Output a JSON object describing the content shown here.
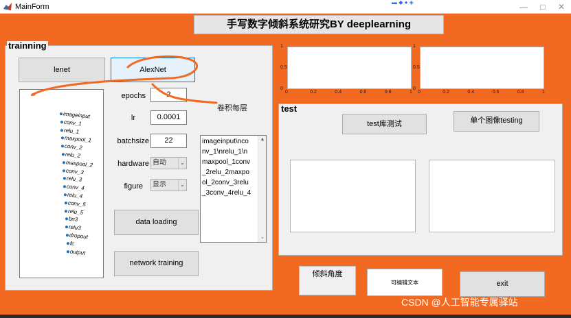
{
  "window": {
    "title": "MainForm",
    "controls": [
      "—",
      "□",
      "✕"
    ]
  },
  "header": {
    "title": "手写数字倾斜系统研究BY deeplearning"
  },
  "training": {
    "label": "trainning",
    "lenet_label": "lenet",
    "alexnet_label": "AlexNet",
    "epochs_label": "epochs",
    "epochs_value": "2",
    "lr_label": "lr",
    "lr_value": "0.0001",
    "batchsize_label": "batchsize",
    "batchsize_value": "22",
    "hardware_label": "hardware",
    "hardware_value": "自动",
    "figure_label": "figure",
    "figure_value": "显示",
    "data_loading_label": "data loading",
    "network_training_label": "network training",
    "layers": [
      "imageinput",
      "conv_1",
      "relu_1",
      "maxpool_1",
      "conv_2",
      "relu_2",
      "maxpool_2",
      "conv_3",
      "relu_3",
      "conv_4",
      "relu_4",
      "conv_5",
      "relu_5",
      "bn3",
      "relu3",
      "dropout",
      "fc",
      "output"
    ],
    "layer_text_lines": [
      "imageinput\\nco",
      "nv_1\\nrelu_1\\n",
      "maxpool_1conv",
      "_2relu_2maxpo",
      "ol_2conv_3relu",
      "_3conv_4relu_4"
    ]
  },
  "plots": {
    "y_ticks": [
      "1",
      "0.5",
      "0"
    ],
    "x_ticks": [
      "0",
      "0.2",
      "0.4",
      "0.6",
      "0.8",
      "1"
    ]
  },
  "test": {
    "label": "test",
    "testlib_label": "test库测试",
    "single_label": "单个图像testing"
  },
  "bottom": {
    "tilt_label": "倾斜角度",
    "editable_text": "可编辑文本",
    "exit_label": "exit"
  },
  "annotation": "卷积每层",
  "watermark": "CSDN @人工智能专属驿站",
  "colors": {
    "background": "#f26a22",
    "panel": "#f0f0f0",
    "accent": "#0078d7",
    "annotation_stroke": "#f26a22"
  }
}
